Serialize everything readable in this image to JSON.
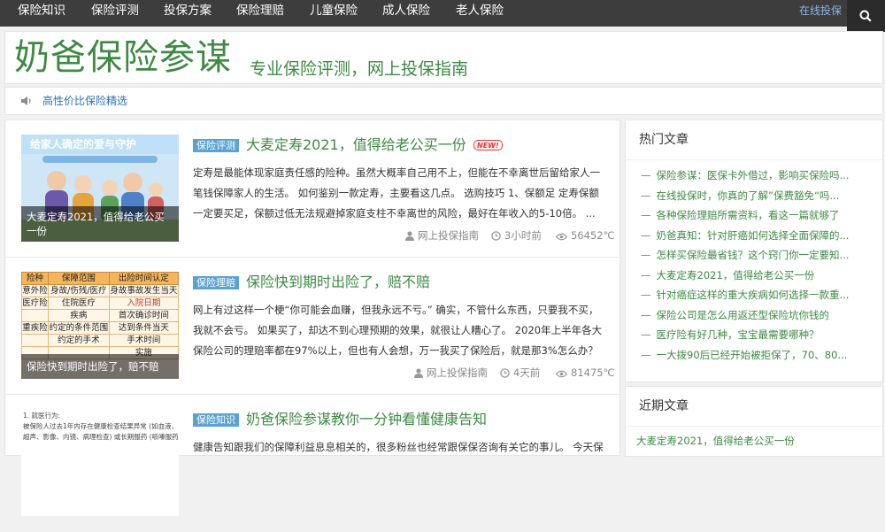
{
  "nav": {
    "items": [
      "保险知识",
      "保险评测",
      "投保方案",
      "保险理赔",
      "儿童保险",
      "成人保险",
      "老人保险"
    ],
    "online": "在线投保",
    "search_icon": "search-icon"
  },
  "header": {
    "logo": "奶爸保险参谋",
    "slogan": "专业保险评测，网上投保指南"
  },
  "notice": {
    "icon": "speaker-icon",
    "text": "高性价比保险精选"
  },
  "posts": [
    {
      "category": "保险评测",
      "title": "大麦定寿2021，值得给老公买一份",
      "badge": "NEW!",
      "thumb_caption": "大麦定寿2021，值得给老公买一份",
      "thumb_banner": "给家人确定的爱与守护",
      "excerpt": "定寿是最能体现家庭责任感的险种。虽然大概率自己用不上，但能在不幸离世后留给家人一笔钱保障家人的生活。 如何鉴别一款定寿，主要看这几点。 选购技巧 1、保额足 定寿保额一定要买足，保额过低无法规避掉家庭支柱不幸离世的风险，最好在年收入的5-10倍。 ...",
      "author": "网上投保指南",
      "time": "3小时前",
      "views": "56452℃"
    },
    {
      "category": "保险理赔",
      "title": "保险快到期时出险了，赔不赔",
      "thumb_caption": "保险快到期时出险了，赔不赔",
      "excerpt": "网上有过这样一个梗“你可能会血赚，但我永远不亏。” 确实，不管什么东西，只要我不买，我就不会亏。 如果买了，却达不到心理预期的效果，就很让人糟心了。 2020年上半年各大保险公司的理赔率都在97%以上，但也有人会想，万一我买了保险后，就是那3%怎么办？ 确实有...",
      "author": "网上投保指南",
      "time": "4天前",
      "views": "81475℃",
      "table": {
        "headers": [
          "险种",
          "保障范围",
          "出险时间认定"
        ],
        "rows": [
          [
            "意外险",
            "身故/伤残/医疗",
            "身故事故发生当天"
          ],
          [
            "医疗险",
            "住院医疗",
            "入院日期"
          ],
          [
            "",
            "疾病",
            "首次确诊时间"
          ],
          [
            "重疾险",
            "约定的条件范围",
            "达到条件当天"
          ],
          [
            "",
            "约定的手术",
            "手术时间"
          ],
          [
            "",
            "",
            "实施"
          ]
        ]
      }
    },
    {
      "category": "保险知识",
      "title": "奶爸保险参谋教你一分钟看懂健康告知",
      "excerpt": "健康告知跟我们的保障利益息息相关的，很多粉丝也经常跟保保咨询有关它的事儿。 今天保",
      "thumb_lines": [
        "1. 就医行为:",
        "被保险人过去1年内存在健康检查结果异常 (如血液、",
        "超声、影像、内镜、病理检查) 或长期服药 (哌嗪服药"
      ]
    }
  ],
  "hot": {
    "title": "热门文章",
    "items": [
      "保险参谋：医保卡外借过，影响买保险吗...",
      "在线投保时，你真的了解”保费豁免“吗...",
      "各种保险理赔所需资料，看这一篇就够了",
      "奶爸真知：针对肝癌如何选择全面保障的...",
      "怎样买保险最省钱？这个窍门你一定要知...",
      "大麦定寿2021，值得给老公买一份",
      "针对癌症这样的重大疾病如何选择一款重...",
      "保险公司是怎么用返还型保险坑你钱的",
      "医疗险有好几种，宝宝最需要哪种？",
      "一大拨90后已经开始被拒保了，70、80..."
    ]
  },
  "recent": {
    "title": "近期文章",
    "items": [
      "大麦定寿2021，值得给老公买一份"
    ]
  },
  "colors": {
    "nav_bg": "#3d3d3d",
    "brand_green": "#3d8a43",
    "category_blue": "#5ba2d4",
    "link_blue": "#2e6fb7",
    "new_red": "#ee3333"
  }
}
